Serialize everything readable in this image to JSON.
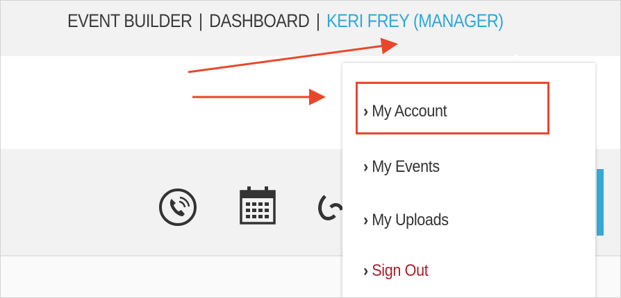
{
  "topnav": {
    "event_builder": "EVENT BUILDER",
    "sep1": "|",
    "dashboard": "DASHBOARD",
    "sep2": "|",
    "user": "KERI FREY (MANAGER)"
  },
  "dropdown": {
    "items": [
      {
        "label": "My Account"
      },
      {
        "label": "My Events"
      },
      {
        "label": "My Uploads"
      },
      {
        "label": "Sign Out"
      }
    ]
  },
  "icons": {
    "chevron": "›",
    "phone": "phone-icon",
    "calendar": "calendar-icon",
    "link": "link-icon"
  },
  "colors": {
    "user_link": "#2ea8d8",
    "sign_out": "#a3232b",
    "annotation": "#e8472b",
    "accent_bar": "#35a9d6",
    "bar_background": "#f2f2f2"
  }
}
